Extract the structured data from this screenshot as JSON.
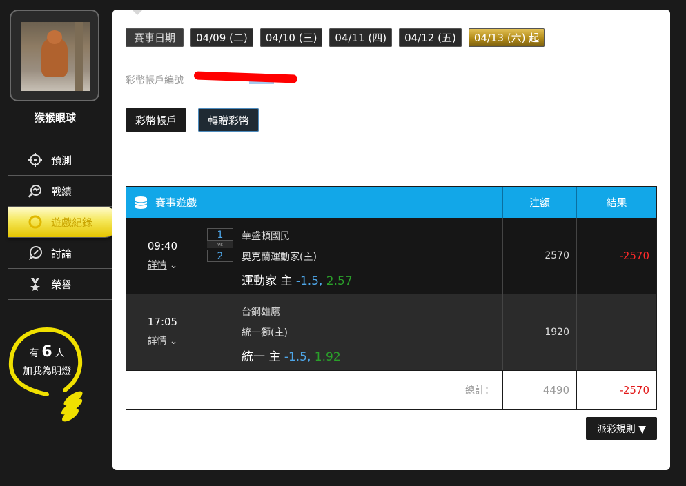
{
  "sidebar": {
    "username": "猴猴眼球",
    "menu": [
      {
        "label": "預測",
        "icon": "crosshair-icon"
      },
      {
        "label": "戰績",
        "icon": "stats-icon"
      },
      {
        "label": "遊戲紀錄",
        "icon": "coin-icon",
        "active": true
      },
      {
        "label": "討論",
        "icon": "chat-icon"
      },
      {
        "label": "榮譽",
        "icon": "medal-icon"
      }
    ],
    "fans": {
      "prefix": "有",
      "count": "6",
      "suffix": "人",
      "line2": "加我為明燈"
    }
  },
  "dates": {
    "label": "賽事日期",
    "items": [
      "04/09 (二)",
      "04/10 (三)",
      "04/11 (四)",
      "04/12 (五)",
      "04/13 (六) 起"
    ],
    "active_index": 4
  },
  "account": {
    "label": "彩幣帳戶編號"
  },
  "buttons": {
    "account": "彩幣帳戶",
    "transfer": "轉贈彩幣"
  },
  "table": {
    "headers": {
      "game": "賽事遊戲",
      "stake": "注額",
      "result": "結果"
    },
    "rows": [
      {
        "time": "09:40",
        "detail": "詳情",
        "score_away": "1",
        "vs": "vs",
        "score_home": "2",
        "team_away": "華盛頓國民",
        "team_home": "奧克蘭運動家(主)",
        "pick_team": "運動家 主",
        "pick_line": "-1.5,",
        "pick_odds": "2.57",
        "stake": "2570",
        "result": "-2570"
      },
      {
        "time": "17:05",
        "detail": "詳情",
        "team_away": "台鋼雄鷹",
        "team_home": "統一獅(主)",
        "pick_team": "統一 主",
        "pick_line": "-1.5,",
        "pick_odds": "1.92",
        "stake": "1920",
        "result": ""
      }
    ],
    "total": {
      "label": "總計：",
      "stake": "4490",
      "result": "-2570"
    }
  },
  "rules_button": "派彩規則 ▼",
  "colors": {
    "header_blue": "#12a7e8",
    "loss_red": "#ff2a2a",
    "gold": "#e6c55a"
  }
}
